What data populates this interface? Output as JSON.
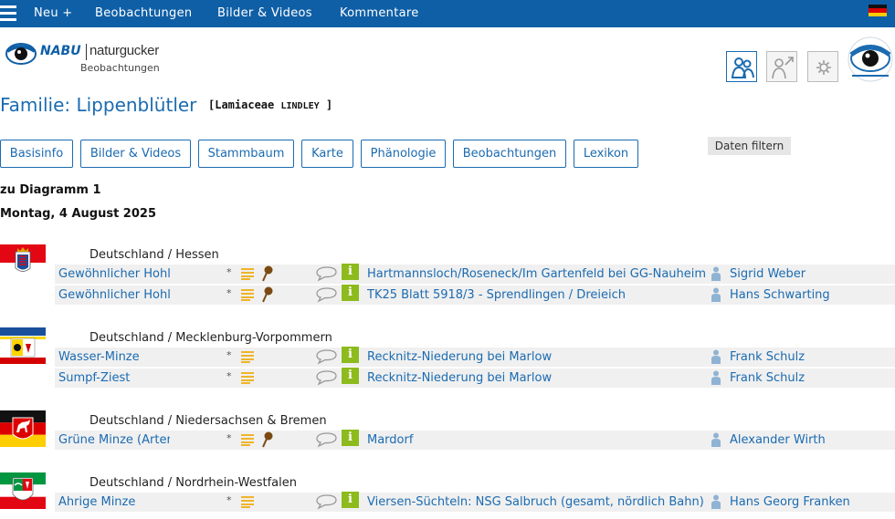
{
  "nav": {
    "new_label": "Neu +",
    "items": [
      "Beobachtungen",
      "Bilder & Videos",
      "Kommentare"
    ],
    "language_flag": "de-flag"
  },
  "logo": {
    "brand": "NABU",
    "product": "naturgucker",
    "subtitle": "Beobachtungen"
  },
  "title": {
    "main": "Familie: Lippenblütler",
    "latin_open": "[Lamiaceae ",
    "author": "Lindley",
    "latin_close": "]"
  },
  "tabs": [
    "Basisinfo",
    "Bilder & Videos",
    "Stammbaum",
    "Karte",
    "Phänologie",
    "Beobachtungen",
    "Lexikon"
  ],
  "filter_label": "Daten filtern",
  "diagram_link": "zu Diagramm 1",
  "date_heading": "Montag, 4 August 2025",
  "groups": [
    {
      "region": "Deutschland / Hessen",
      "rows": [
        {
          "species": "Gewöhnlicher Hohlzahn",
          "location": "Hartmannsloch/Roseneck/Im Gartenfeld bei GG-Nauheim",
          "observer": "Sigrid Weber",
          "has_pin": true
        },
        {
          "species": "Gewöhnlicher Hohlzahn",
          "location": "TK25 Blatt 5918/3 - Sprendlingen / Dreieich",
          "observer": "Hans Schwarting",
          "has_pin": true
        }
      ]
    },
    {
      "region": "Deutschland / Mecklenburg-Vorpommern",
      "rows": [
        {
          "species": "Wasser-Minze",
          "location": "Recknitz-Niederung bei Marlow",
          "observer": "Frank Schulz",
          "has_pin": false
        },
        {
          "species": "Sumpf-Ziest",
          "location": "Recknitz-Niederung bei Marlow",
          "observer": "Frank Schulz",
          "has_pin": false
        }
      ]
    },
    {
      "region": "Deutschland / Niedersachsen & Bremen",
      "rows": [
        {
          "species": "Grüne Minze (Artengruppe)",
          "location": "Mardorf",
          "observer": "Alexander Wirth",
          "has_pin": true
        }
      ]
    },
    {
      "region": "Deutschland / Nordrhein-Westfalen",
      "rows": [
        {
          "species": "Ährige Minze",
          "location": "Viersen-Süchteln: NSG Salbruch (gesamt, nördlich Bahn)",
          "observer": "Hans Georg Franken",
          "has_pin": false
        }
      ]
    }
  ],
  "row_star": "*",
  "info_glyph": "i",
  "colors": {
    "nav_bg": "#0f5fa6",
    "link": "#1b6bb0",
    "row_bg": "#f0f0f0",
    "info_green": "#8dbb1d",
    "notes_orange": "#f0b429",
    "pin_brown": "#7a4a12"
  }
}
